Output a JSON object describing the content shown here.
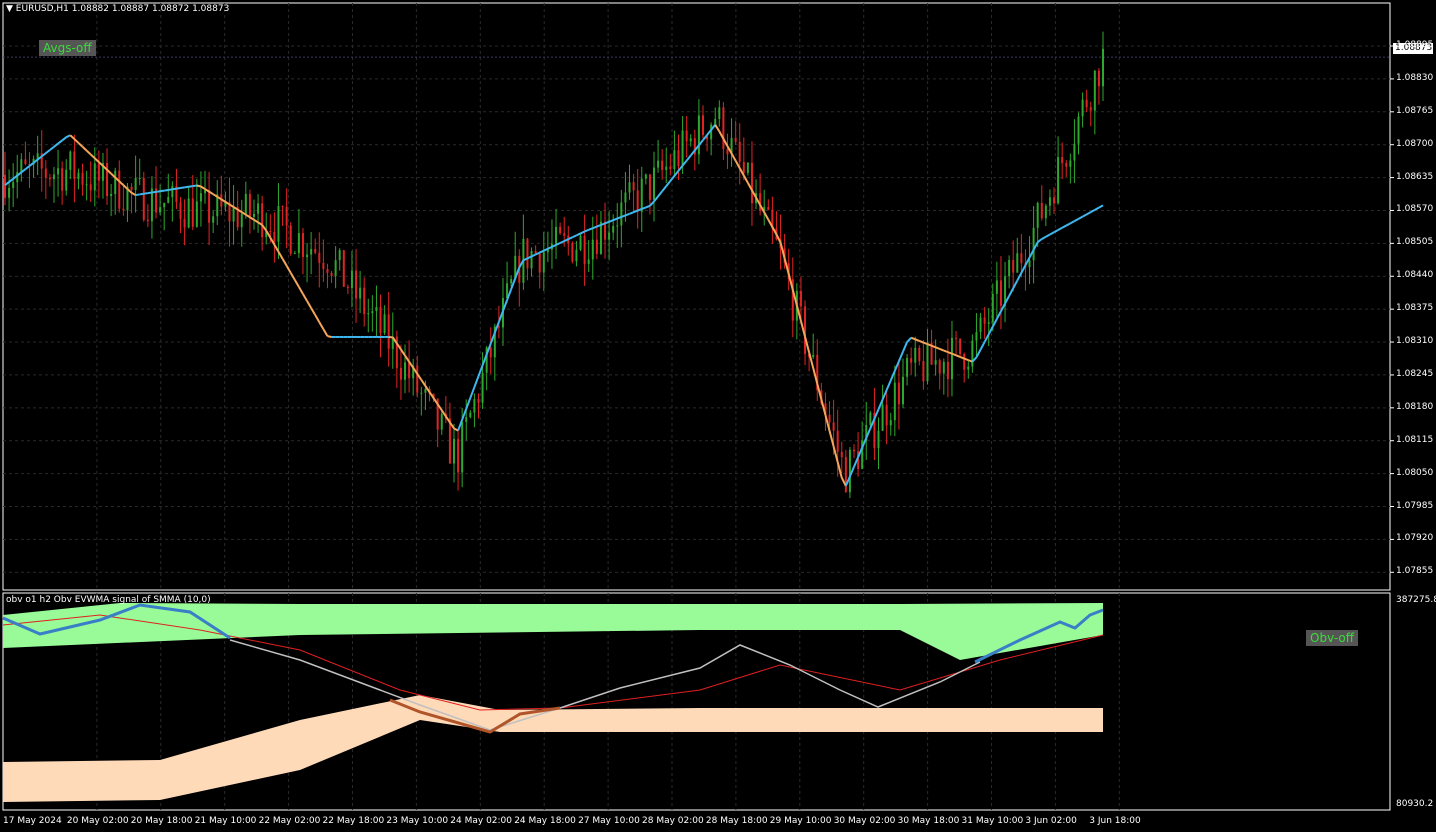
{
  "header": {
    "symbol_timeframe": "EURUSD,H1",
    "open": "1.08882",
    "high": "1.08887",
    "low": "1.08872",
    "close": "1.08873"
  },
  "buttons": {
    "avgs": "Avgs-off",
    "obv": "Obv-off"
  },
  "indicator": {
    "title": "obv o1 h2 Obv EVWMA signal of SMMA (10,0)",
    "max_label": "387275.8",
    "min_label": "80930.2"
  },
  "current_price_label": "1.08873",
  "price_axis": [
    "1.08895",
    "1.08830",
    "1.08765",
    "1.08700",
    "1.08635",
    "1.08570",
    "1.08505",
    "1.08440",
    "1.08375",
    "1.08310",
    "1.08245",
    "1.08180",
    "1.08115",
    "1.08050",
    "1.07985",
    "1.07920",
    "1.07855"
  ],
  "time_axis": [
    "17 May 2024",
    "20 May 02:00",
    "20 May 18:00",
    "21 May 10:00",
    "22 May 02:00",
    "22 May 18:00",
    "23 May 10:00",
    "24 May 02:00",
    "24 May 18:00",
    "27 May 10:00",
    "28 May 02:00",
    "28 May 18:00",
    "29 May 10:00",
    "30 May 02:00",
    "30 May 18:00",
    "31 May 10:00",
    "3 Jun 02:00",
    "3 Jun 18:00"
  ],
  "colors": {
    "bull": "#2ea82e",
    "bear": "#e02424",
    "ma_up": "#3fb8f0",
    "ma_down": "#f5a65b",
    "grid": "#2a2a2a",
    "band_green": "#98fb98",
    "band_peach": "#ffdab9",
    "obv_line": "#c0c0c0",
    "signal_line": "#e02020",
    "obv_up": "#3a7ec8",
    "obv_down": "#b0552a"
  },
  "chart_data": {
    "type": "candlestick",
    "symbol": "EURUSD",
    "timeframe": "H1",
    "ylim": [
      1.0782,
      1.0898
    ],
    "x": [
      "17 May 2024",
      "20 May 02:00",
      "20 May 18:00",
      "21 May 10:00",
      "22 May 02:00",
      "22 May 18:00",
      "23 May 10:00",
      "24 May 02:00",
      "24 May 18:00",
      "27 May 10:00",
      "28 May 02:00",
      "28 May 18:00",
      "29 May 10:00",
      "30 May 02:00",
      "30 May 18:00",
      "31 May 10:00",
      "3 Jun 02:00",
      "3 Jun 18:00"
    ],
    "close": [
      1.0864,
      1.0865,
      1.086,
      1.0857,
      1.0856,
      1.0848,
      1.083,
      1.0808,
      1.0848,
      1.0851,
      1.0862,
      1.0876,
      1.0848,
      1.0805,
      1.0825,
      1.083,
      1.0855,
      1.08873
    ],
    "moving_average": [
      1.0862,
      1.0872,
      1.086,
      1.0862,
      1.0854,
      1.0832,
      1.0832,
      1.0813,
      1.0847,
      1.0853,
      1.0858,
      1.0874,
      1.0851,
      1.0802,
      1.0832,
      1.0827,
      1.0851,
      1.0858
    ]
  }
}
